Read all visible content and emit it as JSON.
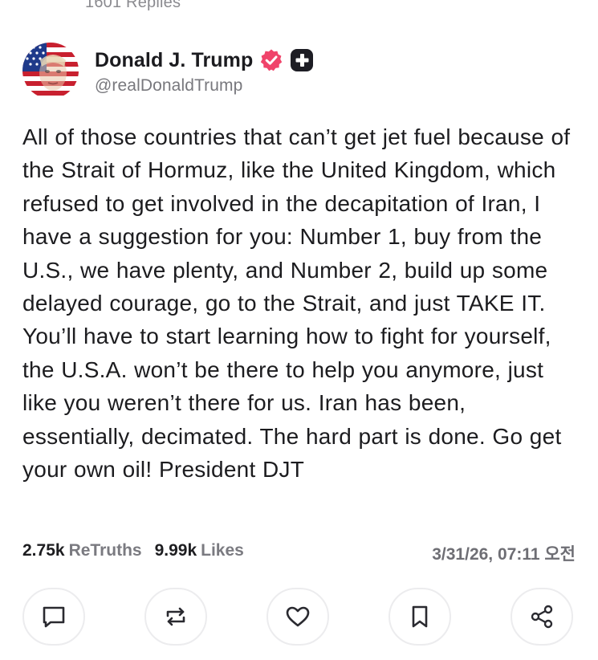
{
  "previous_post": {
    "replies_text": "1601 Replies"
  },
  "author": {
    "display_name": "Donald J. Trump",
    "handle": "@realDonaldTrump",
    "verified": true,
    "avatar_icon": "american-flag-portrait",
    "verified_color": "#f0436a",
    "badge_icon": "plus-badge"
  },
  "post": {
    "text": "All of those countries that can’t get jet fuel because of the Strait of Hormuz, like the United Kingdom, which refused to get involved in the decapitation of Iran, I have a suggestion for you: Number 1, buy from the U.S., we have plenty, and Number 2, build up some delayed courage, go to the Strait, and just TAKE IT. You’ll have to start learning how to fight for yourself, the U.S.A. won’t be there to help you anymore, just like you weren’t there for us. Iran has been, essentially, decimated. The hard part is done. Go get your own oil! President DJT"
  },
  "stats": {
    "retruths_count": "2.75k",
    "retruths_label": "ReTruths",
    "likes_count": "9.99k",
    "likes_label": "Likes",
    "timestamp": "3/31/26, 07:11 오전"
  },
  "actions": [
    {
      "name": "reply-button",
      "icon": "comment-icon"
    },
    {
      "name": "retruth-button",
      "icon": "repost-icon"
    },
    {
      "name": "like-button",
      "icon": "heart-icon"
    },
    {
      "name": "bookmark-button",
      "icon": "bookmark-icon"
    },
    {
      "name": "share-button",
      "icon": "share-icon"
    }
  ],
  "colors": {
    "text": "#1c1c1f",
    "muted": "#78787d",
    "button_border": "#ececee"
  }
}
